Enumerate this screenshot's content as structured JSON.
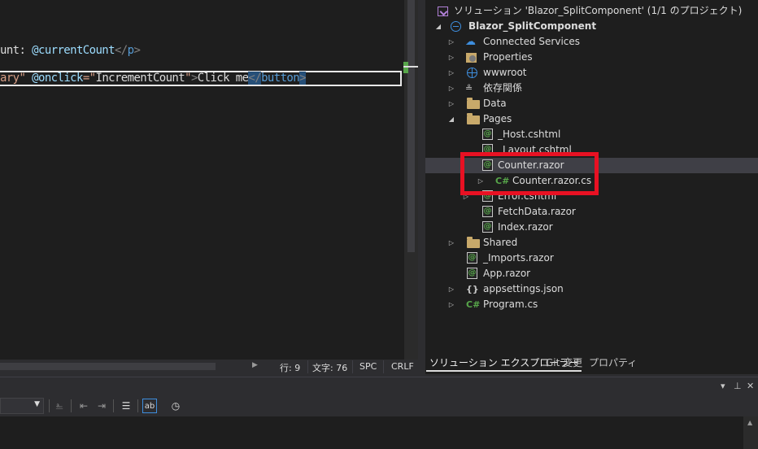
{
  "editor": {
    "line2": {
      "t1": "unt: ",
      "t2": "@currentCount",
      "t3": "</",
      "t4": "p",
      "t5": ">"
    },
    "line4": {
      "t1": "ary",
      "t2": "\" ",
      "t3": "@onclick",
      "t4": "=\"",
      "t5": "IncrementCount",
      "t6": "\"",
      "t7": ">",
      "t8": "Click me",
      "t9": "</",
      "t10": "button",
      "t11": ">"
    }
  },
  "status": {
    "line": "行: 9",
    "char": "文字: 76",
    "whitespace": "SPC",
    "line_ending": "CRLF"
  },
  "solution_explorer": {
    "solution_title": "ソリューション 'Blazor_SplitComponent' (1/1 のプロジェクト)",
    "project": "Blazor_SplitComponent",
    "items": [
      {
        "label": "Connected Services",
        "icon": "cloud-icon"
      },
      {
        "label": "Properties",
        "icon": "properties-icon"
      },
      {
        "label": "wwwroot",
        "icon": "globe-icon"
      },
      {
        "label": "依存関係",
        "icon": "dependencies-icon"
      },
      {
        "label": "Data",
        "icon": "folder-icon"
      },
      {
        "label": "Pages",
        "icon": "folder-icon"
      },
      {
        "label": "_Host.cshtml",
        "icon": "razor-file-icon"
      },
      {
        "label": "_Layout.cshtml",
        "icon": "razor-file-icon"
      },
      {
        "label": "Counter.razor",
        "icon": "razor-file-icon"
      },
      {
        "label": "Counter.razor.cs",
        "icon": "csharp-file-icon"
      },
      {
        "label": "Error.cshtml",
        "icon": "razor-file-icon"
      },
      {
        "label": "FetchData.razor",
        "icon": "razor-file-icon"
      },
      {
        "label": "Index.razor",
        "icon": "razor-file-icon"
      },
      {
        "label": "Shared",
        "icon": "folder-icon"
      },
      {
        "label": "_Imports.razor",
        "icon": "razor-file-icon"
      },
      {
        "label": "App.razor",
        "icon": "razor-file-icon"
      },
      {
        "label": "appsettings.json",
        "icon": "json-file-icon"
      },
      {
        "label": "Program.cs",
        "icon": "csharp-file-icon"
      }
    ],
    "tabs": [
      "ソリューション エクスプローラー",
      "Git 変更",
      "プロパティ"
    ],
    "cs_glyph": "C#",
    "razor_glyph": "@"
  },
  "colors": {
    "highlight_box": "#e81123",
    "background": "#1e1e1e",
    "selected_row": "#3f3f46"
  }
}
